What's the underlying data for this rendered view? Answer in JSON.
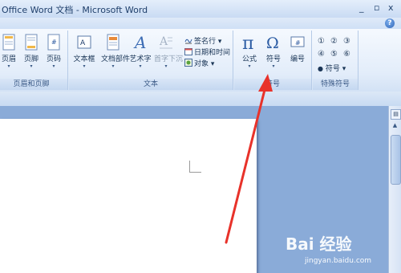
{
  "window": {
    "title": "Office Word 文档 - Microsoft Word",
    "controls": [
      "_",
      "▫",
      "x"
    ]
  },
  "ribbon": {
    "groups": {
      "header_footer": {
        "label": "页眉和页脚",
        "buttons": [
          {
            "label": "页眉",
            "icon": "header-icon"
          },
          {
            "label": "页脚",
            "icon": "footer-icon"
          },
          {
            "label": "页码",
            "icon": "page-number-icon"
          }
        ]
      },
      "text": {
        "label": "文本",
        "buttons": [
          {
            "label": "文本框",
            "icon": "textbox-icon"
          },
          {
            "label": "文档部件",
            "icon": "quick-parts-icon"
          },
          {
            "label": "艺术字",
            "icon": "wordart-icon"
          },
          {
            "label": "首字下沉",
            "icon": "drop-cap-icon",
            "disabled": true
          }
        ],
        "small": [
          {
            "label": "签名行 ▾",
            "icon": "signature-line-icon"
          },
          {
            "label": "日期和时间",
            "icon": "date-time-icon"
          },
          {
            "label": "对象 ▾",
            "icon": "object-icon"
          }
        ]
      },
      "symbols": {
        "label": "符号",
        "buttons": [
          {
            "label": "公式",
            "icon": "pi-equation-icon"
          },
          {
            "label": "符号",
            "icon": "omega-symbol-icon"
          },
          {
            "label": "编号",
            "icon": "numbering-icon"
          }
        ]
      },
      "special": {
        "label": "特殊符号",
        "symbols": [
          "①",
          "②",
          "③",
          "④",
          "⑤",
          "⑥"
        ],
        "more_label": "符号 ▾"
      }
    }
  },
  "watermark": {
    "main": "Bai 经验",
    "sub": "jingyan.baidu.com"
  },
  "colors": {
    "annotation_arrow": "#e8322a",
    "workspace": "#8aabd8",
    "page": "#ffffff"
  }
}
